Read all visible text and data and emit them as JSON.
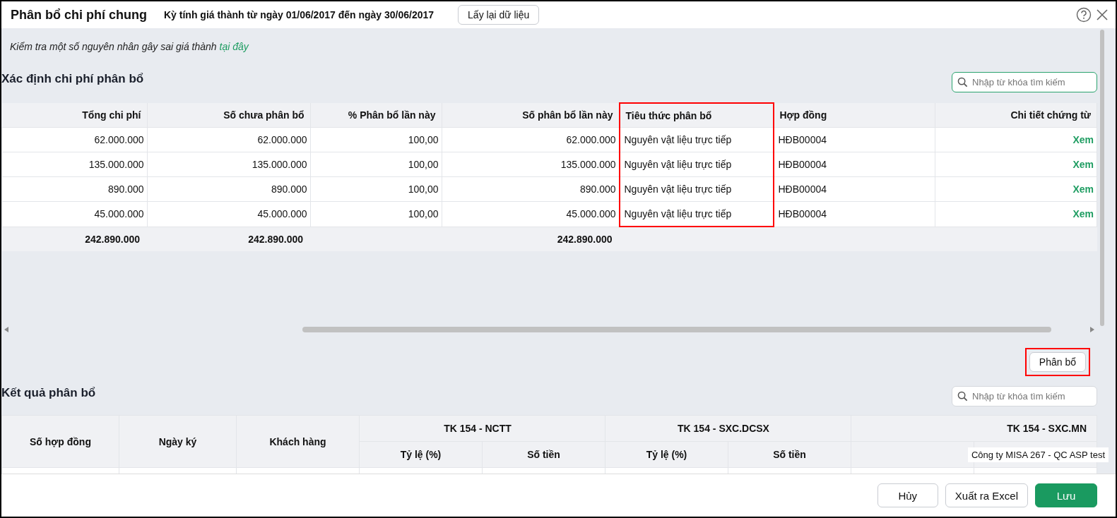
{
  "window": {
    "title": "Phân bổ chi phí chung",
    "period": "Kỳ tính giá thành từ ngày 01/06/2017 đến ngày 30/06/2017",
    "reload_button": "Lấy lại dữ liệu"
  },
  "notice": {
    "text": "Kiểm tra một số nguyên nhân gây sai giá thành",
    "link": "tại đây"
  },
  "allocation": {
    "title": "Xác định chi phí phân bổ",
    "search": {
      "placeholder": "Nhập từ khóa tìm kiếm",
      "focused": true
    },
    "columns": [
      {
        "label": "Tổng chi phí",
        "highlighted": false,
        "total": "242.890.000"
      },
      {
        "label": "Số chưa phân bổ",
        "highlighted": false,
        "total": "242.890.000"
      },
      {
        "label": "% Phân bổ lần này",
        "highlighted": false
      },
      {
        "label": "Số phân bổ lần này",
        "highlighted": false,
        "total": "242.890.000"
      },
      {
        "label": "Tiêu thức phân bổ",
        "highlighted": true
      },
      {
        "label": "Hợp đồng",
        "highlighted": false
      },
      {
        "label": "Chi tiết chứng từ",
        "highlighted": false
      }
    ],
    "rows": [
      [
        "62.000.000",
        "62.000.000",
        "100,00",
        "62.000.000",
        "Nguyên vật liệu trực tiếp",
        "HĐB00004",
        "Xem"
      ],
      [
        "135.000.000",
        "135.000.000",
        "100,00",
        "135.000.000",
        "Nguyên vật liệu trực tiếp",
        "HĐB00004",
        "Xem"
      ],
      [
        "890.000",
        "890.000",
        "100,00",
        "890.000",
        "Nguyên vật liệu trực tiếp",
        "HĐB00004",
        "Xem"
      ],
      [
        "45.000.000",
        "45.000.000",
        "100,00",
        "45.000.000",
        "Nguyên vật liệu trực tiếp",
        "HĐB00004",
        "Xem"
      ]
    ],
    "allocate_button": {
      "label": "Phân bổ",
      "highlighted": true
    }
  },
  "result": {
    "title": "Kết quả phân bổ",
    "search": {
      "placeholder": "Nhập từ khóa tìm kiếm",
      "focused": false
    },
    "columns": [
      {
        "label": "Số hợp đồng",
        "kind": "single"
      },
      {
        "label": "Ngày ký",
        "kind": "single"
      },
      {
        "label": "Khách hàng",
        "kind": "single"
      },
      {
        "label": "TK 154 - NCTT",
        "kind": "group",
        "children": [
          "Tỷ lệ (%)",
          "Số tiền"
        ]
      },
      {
        "label": "TK 154 - SXC.DCSX",
        "kind": "group",
        "children": [
          "Tỷ lệ (%)",
          "Số tiền"
        ]
      },
      {
        "label": "TK 154 - SXC.MN",
        "kind": "group"
      }
    ]
  },
  "tooltip": "Công ty MISA 267 - QC ASP test",
  "buttons": [
    {
      "label": "Hủy",
      "kind": "secondary"
    },
    {
      "label": "Xuất ra Excel",
      "kind": "secondary"
    },
    {
      "label": "Lưu",
      "kind": "primary"
    }
  ]
}
